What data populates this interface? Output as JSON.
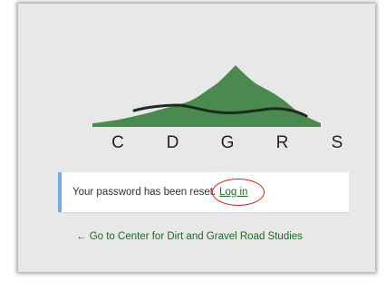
{
  "logo": {
    "letters": [
      "C",
      "D",
      "G",
      "R",
      "S"
    ],
    "mountain_color": "#4a8a4e",
    "road_color": "#1f2a1f"
  },
  "notice": {
    "message": "Your password has been reset.",
    "login_link": "Log in",
    "border_color": "#72aee6",
    "highlight_color": "#d42222"
  },
  "back_link": {
    "text": "← Go to Center for Dirt and Gravel Road Studies"
  }
}
